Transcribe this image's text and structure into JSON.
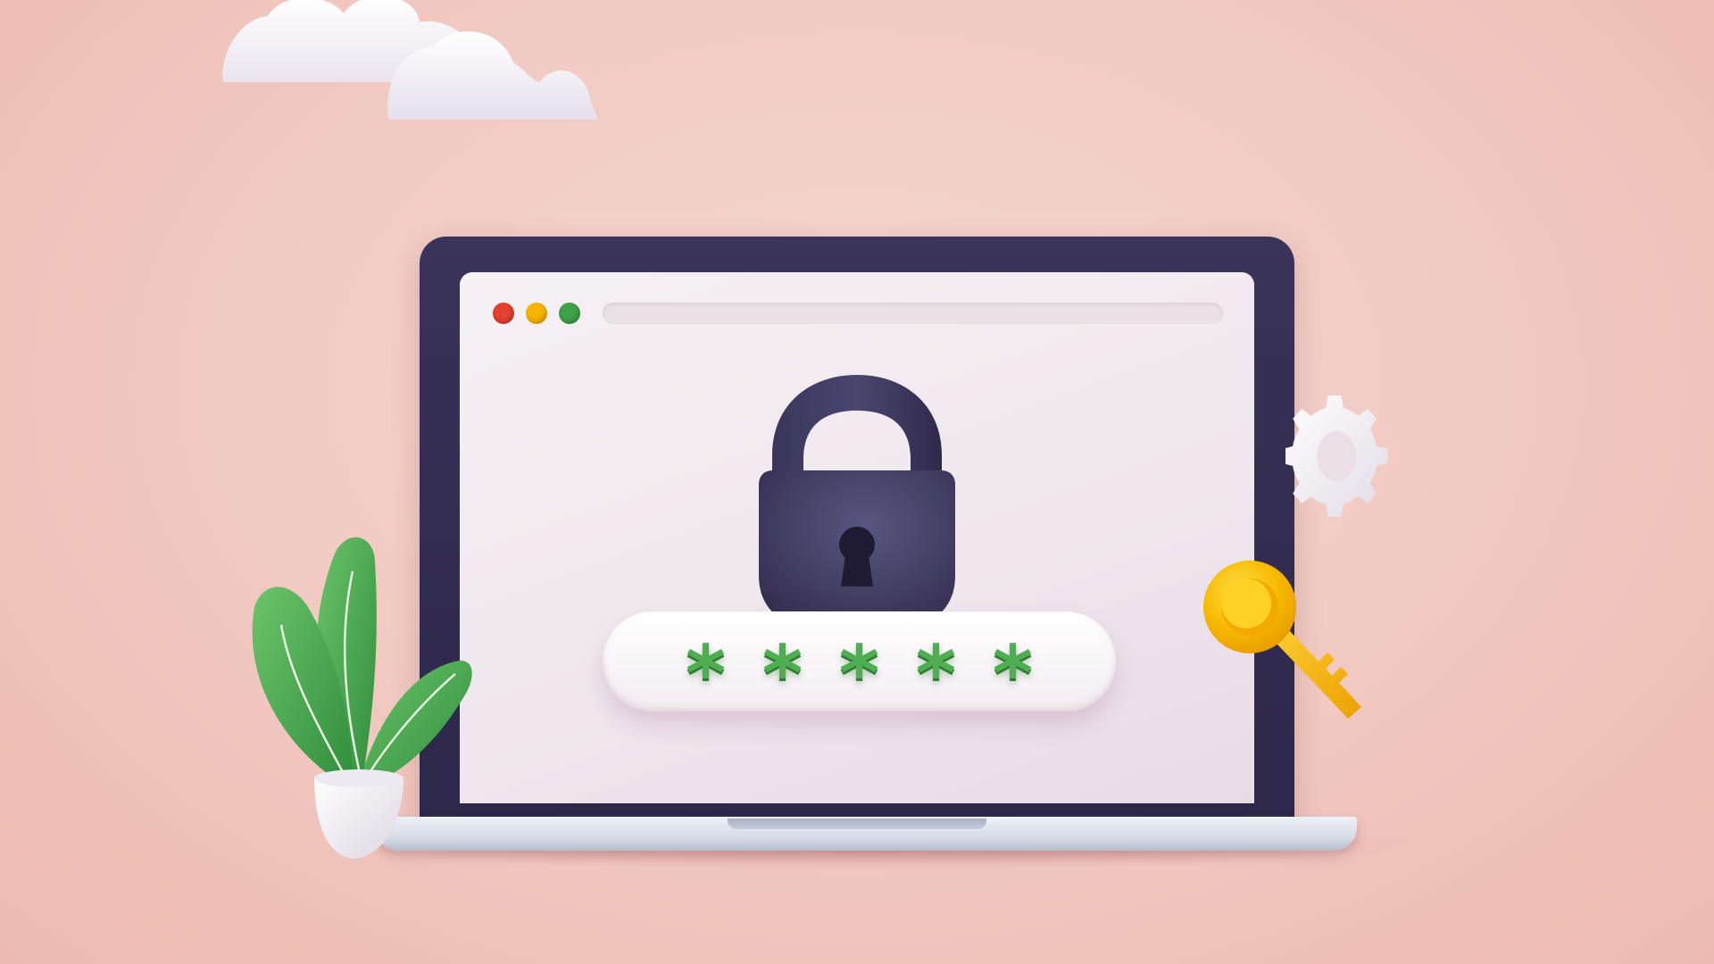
{
  "scene": {
    "background_color": "#f1c9c1"
  },
  "browser": {
    "window_controls": [
      {
        "name": "close",
        "color": "#e2412f"
      },
      {
        "name": "minimize",
        "color": "#f4b400"
      },
      {
        "name": "maximize",
        "color": "#3ea047"
      }
    ],
    "address_value": ""
  },
  "password_field": {
    "characters": [
      "*",
      "*",
      "*",
      "*",
      "*"
    ],
    "char_color": "#4fae52"
  },
  "icons": {
    "padlock": "padlock-icon",
    "key": "key-icon",
    "gear": "gear-icon",
    "plant": "plant-illustration",
    "clouds": "cloud-icon"
  },
  "colors": {
    "laptop_frame": "#2d2749",
    "padlock_body": "#3f3a5c",
    "key_gold": "#f7b900",
    "leaf_green": "#4caf50"
  }
}
